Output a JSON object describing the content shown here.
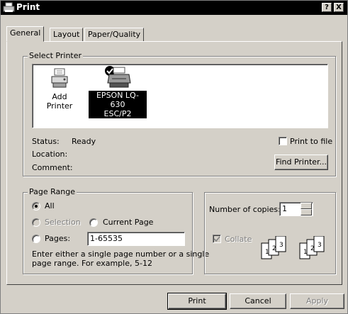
{
  "window": {
    "title": "Print",
    "help_label": "?",
    "close_label": "X"
  },
  "tabs": [
    {
      "label": "General",
      "active": true
    },
    {
      "label": "Layout",
      "active": false
    },
    {
      "label": "Paper/Quality",
      "active": false
    }
  ],
  "select_printer": {
    "legend": "Select Printer",
    "printers": [
      {
        "label": "Add Printer",
        "icon": "add-printer-icon",
        "selected": false
      },
      {
        "label_line1": "EPSON LQ-630",
        "label_line2": "ESC/P2",
        "icon": "printer-icon",
        "selected": true,
        "default": true
      }
    ],
    "status_label": "Status:",
    "status_value": "Ready",
    "location_label": "Location:",
    "location_value": "",
    "comment_label": "Comment:",
    "comment_value": "",
    "print_to_file_label": "Print to file",
    "print_to_file_checked": false,
    "find_printer_label": "Find Printer..."
  },
  "page_range": {
    "legend": "Page Range",
    "all_label": "All",
    "selection_label": "Selection",
    "current_page_label": "Current Page",
    "pages_label": "Pages:",
    "pages_value": "1-65535",
    "selected_option": "All",
    "hint_line1": "Enter either a single page number or a single",
    "hint_line2": "page range.  For example, 5-12"
  },
  "copies": {
    "label": "Number of copies:",
    "value": "1",
    "collate_label": "Collate",
    "collate_checked": true,
    "collate_enabled": false,
    "page_numbers": [
      "1",
      "2",
      "3"
    ]
  },
  "buttons": {
    "print": "Print",
    "cancel": "Cancel",
    "apply": "Apply"
  },
  "colors": {
    "face": "#d4d0c8",
    "titlebar": "#000000",
    "selection": "#000000"
  }
}
